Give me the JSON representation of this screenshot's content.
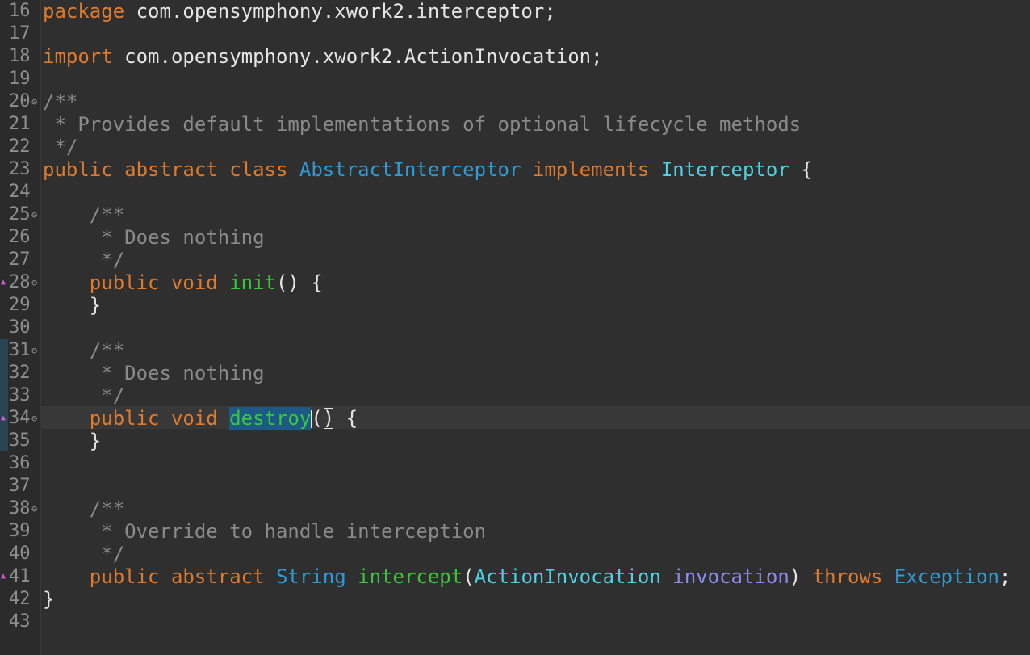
{
  "editor": {
    "lines": [
      {
        "num": "16",
        "fold": "",
        "marker": false,
        "segments": [
          {
            "t": "package",
            "c": "kw"
          },
          {
            "t": " com.opensymphony.xwork2.interceptor;",
            "c": ""
          }
        ]
      },
      {
        "num": "17",
        "fold": "",
        "marker": false,
        "segments": []
      },
      {
        "num": "18",
        "fold": "",
        "marker": false,
        "segments": [
          {
            "t": "import",
            "c": "kw"
          },
          {
            "t": " com.opensymphony.xwork2.ActionInvocation;",
            "c": ""
          }
        ]
      },
      {
        "num": "19",
        "fold": "",
        "marker": false,
        "segments": []
      },
      {
        "num": "20",
        "fold": "⊖",
        "marker": false,
        "segments": [
          {
            "t": "/**",
            "c": "comment"
          }
        ]
      },
      {
        "num": "21",
        "fold": "",
        "marker": false,
        "segments": [
          {
            "t": " * Provides default implementations of optional lifecycle methods",
            "c": "comment"
          }
        ]
      },
      {
        "num": "22",
        "fold": "",
        "marker": false,
        "segments": [
          {
            "t": " */",
            "c": "comment"
          }
        ]
      },
      {
        "num": "23",
        "fold": "",
        "marker": false,
        "segments": [
          {
            "t": "public abstract class ",
            "c": "kw"
          },
          {
            "t": "AbstractInterceptor",
            "c": "cls"
          },
          {
            "t": " implements ",
            "c": "kw"
          },
          {
            "t": "Interceptor",
            "c": "type"
          },
          {
            "t": " {",
            "c": ""
          }
        ]
      },
      {
        "num": "24",
        "fold": "",
        "marker": false,
        "segments": []
      },
      {
        "num": "25",
        "fold": "⊖",
        "marker": false,
        "segments": [
          {
            "t": "    /**",
            "c": "comment"
          }
        ]
      },
      {
        "num": "26",
        "fold": "",
        "marker": false,
        "segments": [
          {
            "t": "     * Does nothing",
            "c": "comment"
          }
        ]
      },
      {
        "num": "27",
        "fold": "",
        "marker": false,
        "segments": [
          {
            "t": "     */",
            "c": "comment"
          }
        ]
      },
      {
        "num": "28",
        "fold": "⊖",
        "marker": true,
        "segments": [
          {
            "t": "    public void ",
            "c": "kw"
          },
          {
            "t": "init",
            "c": "fn"
          },
          {
            "t": "() {",
            "c": ""
          }
        ]
      },
      {
        "num": "29",
        "fold": "",
        "marker": false,
        "segments": [
          {
            "t": "    }",
            "c": ""
          }
        ]
      },
      {
        "num": "30",
        "fold": "",
        "marker": false,
        "segments": []
      },
      {
        "num": "31",
        "fold": "⊖",
        "marker": false,
        "segments": [
          {
            "t": "    /**",
            "c": "comment"
          }
        ]
      },
      {
        "num": "32",
        "fold": "",
        "marker": false,
        "segments": [
          {
            "t": "     * Does nothing",
            "c": "comment"
          }
        ]
      },
      {
        "num": "33",
        "fold": "",
        "marker": false,
        "segments": [
          {
            "t": "     */",
            "c": "comment"
          }
        ]
      },
      {
        "num": "34",
        "fold": "⊖",
        "marker": true,
        "segments": [
          {
            "t": "    public void ",
            "c": "kw"
          },
          {
            "t": "destroy",
            "c": "fn sel"
          },
          {
            "t": "",
            "c": "caret"
          },
          {
            "t": "(",
            "c": ""
          },
          {
            "t": ")",
            "c": "bracket"
          },
          {
            "t": " {",
            "c": ""
          }
        ]
      },
      {
        "num": "35",
        "fold": "",
        "marker": false,
        "segments": [
          {
            "t": "    }",
            "c": ""
          }
        ]
      },
      {
        "num": "36",
        "fold": "",
        "marker": false,
        "segments": []
      },
      {
        "num": "37",
        "fold": "",
        "marker": false,
        "segments": []
      },
      {
        "num": "38",
        "fold": "⊖",
        "marker": false,
        "segments": [
          {
            "t": "    /**",
            "c": "comment"
          }
        ]
      },
      {
        "num": "39",
        "fold": "",
        "marker": false,
        "segments": [
          {
            "t": "     * Override to handle interception",
            "c": "comment"
          }
        ]
      },
      {
        "num": "40",
        "fold": "",
        "marker": false,
        "segments": [
          {
            "t": "     */",
            "c": "comment"
          }
        ]
      },
      {
        "num": "41",
        "fold": "",
        "marker": true,
        "segments": [
          {
            "t": "    public abstract ",
            "c": "kw"
          },
          {
            "t": "String",
            "c": "cls"
          },
          {
            "t": " ",
            "c": ""
          },
          {
            "t": "intercept",
            "c": "fn"
          },
          {
            "t": "(",
            "c": ""
          },
          {
            "t": "ActionInvocation",
            "c": "type"
          },
          {
            "t": " ",
            "c": ""
          },
          {
            "t": "invocation",
            "c": "param"
          },
          {
            "t": ") ",
            "c": ""
          },
          {
            "t": "throws",
            "c": "kw"
          },
          {
            "t": " ",
            "c": ""
          },
          {
            "t": "Exception",
            "c": "cls"
          },
          {
            "t": ";",
            "c": ""
          }
        ]
      },
      {
        "num": "42",
        "fold": "",
        "marker": false,
        "segments": [
          {
            "t": "}",
            "c": ""
          }
        ]
      },
      {
        "num": "43",
        "fold": "",
        "marker": false,
        "segments": []
      }
    ]
  }
}
